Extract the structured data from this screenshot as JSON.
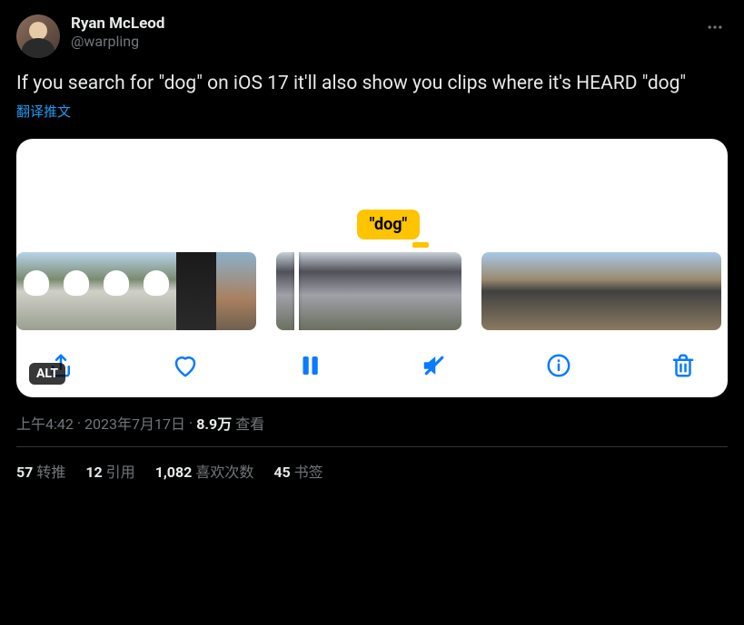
{
  "user": {
    "display_name": "Ryan McLeod",
    "handle": "@warpling"
  },
  "tweet": {
    "text": "If you search for \"dog\" on iOS 17 it'll also show you clips where it's HEARD \"dog\"",
    "translate_label": "翻译推文"
  },
  "media": {
    "caption_label": "\"dog\"",
    "alt_badge": "ALT",
    "toolbar": {
      "share": "share-icon",
      "like": "heart-icon",
      "pause": "pause-icon",
      "mute": "mute-icon",
      "info": "info-icon",
      "trash": "trash-icon"
    }
  },
  "meta": {
    "time": "上午4:42",
    "dot": "·",
    "date": "2023年7月17日",
    "views_count": "8.9万",
    "views_label": "查看"
  },
  "stats": {
    "retweets_count": "57",
    "retweets_label": "转推",
    "quotes_count": "12",
    "quotes_label": "引用",
    "likes_count": "1,082",
    "likes_label": "喜欢次数",
    "bookmarks_count": "45",
    "bookmarks_label": "书签"
  }
}
